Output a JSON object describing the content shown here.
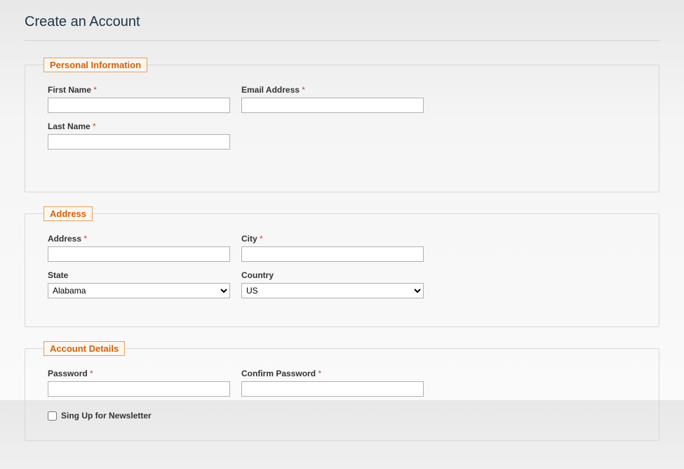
{
  "page": {
    "title": "Create an Account"
  },
  "sections": {
    "personal": {
      "legend": "Personal Information",
      "first_name_label": "First Name",
      "last_name_label": "Last Name",
      "email_label": "Email Address"
    },
    "address": {
      "legend": "Address",
      "address_label": "Address",
      "city_label": "City",
      "state_label": "State",
      "state_value": "Alabama",
      "country_label": "Country",
      "country_value": "US"
    },
    "account": {
      "legend": "Account Details",
      "password_label": "Password",
      "confirm_password_label": "Confirm Password",
      "newsletter_label": "Sing Up for Newsletter"
    }
  },
  "required_marker": "*"
}
